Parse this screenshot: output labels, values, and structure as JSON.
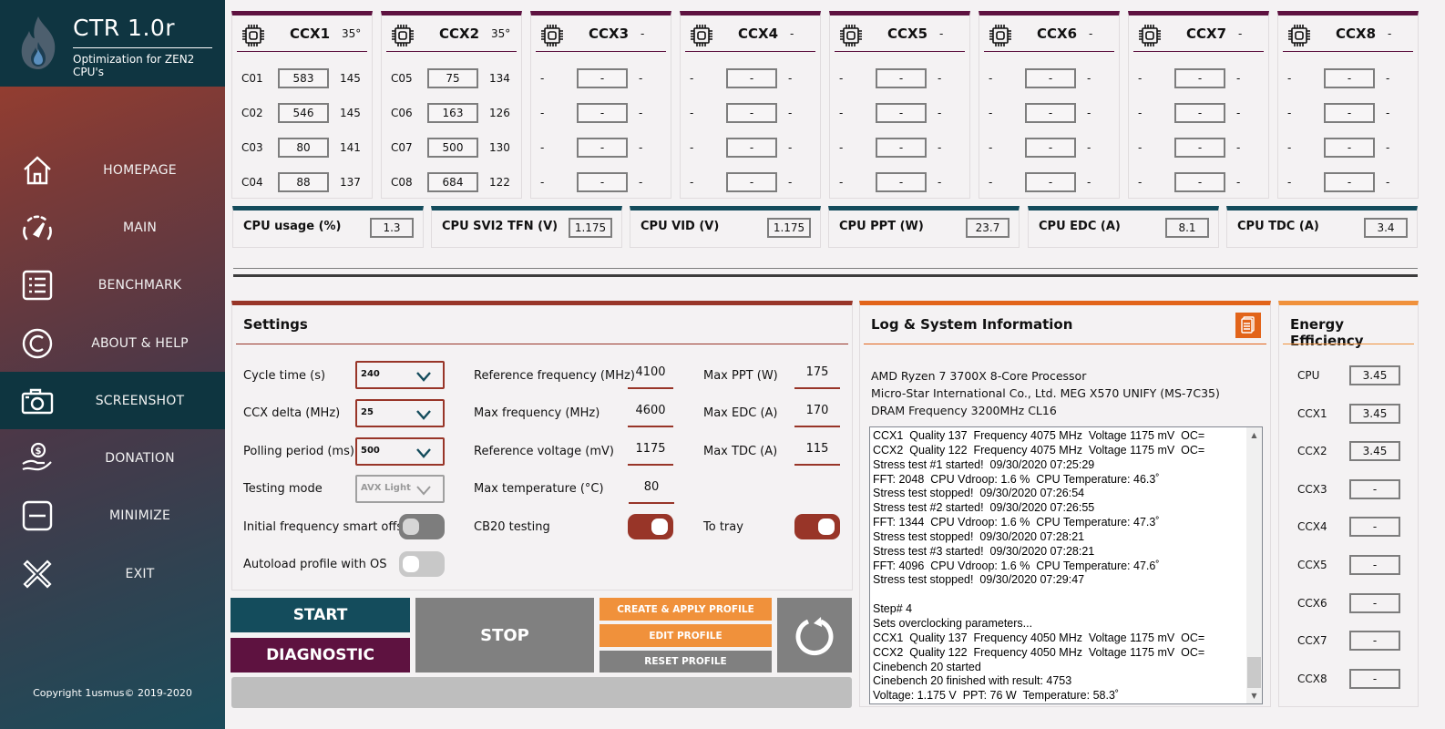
{
  "app": {
    "title": "CTR 1.0r",
    "subtitle": "Optimization for ZEN2 CPU's",
    "copyright": "Copyright 1usmus© 2019-2020"
  },
  "sidebar": {
    "items": [
      {
        "label": "HOMEPAGE",
        "icon": "home-icon",
        "active": false
      },
      {
        "label": "MAIN",
        "icon": "speedometer-icon",
        "active": false
      },
      {
        "label": "BENCHMARK",
        "icon": "list-icon",
        "active": false
      },
      {
        "label": "ABOUT & HELP",
        "icon": "copyright-icon",
        "active": false
      },
      {
        "label": "SCREENSHOT",
        "icon": "camera-icon",
        "active": true
      },
      {
        "label": "DONATION",
        "icon": "donation-hand-icon",
        "active": false
      },
      {
        "label": "MINIMIZE",
        "icon": "minimize-icon",
        "active": false
      },
      {
        "label": "EXIT",
        "icon": "close-icon",
        "active": false
      }
    ]
  },
  "ccx": [
    {
      "name": "CCX1",
      "temp": "35°",
      "cores": [
        {
          "label": "C01",
          "value": "583",
          "quality": "145"
        },
        {
          "label": "C02",
          "value": "546",
          "quality": "145"
        },
        {
          "label": "C03",
          "value": "80",
          "quality": "141"
        },
        {
          "label": "C04",
          "value": "88",
          "quality": "137"
        }
      ]
    },
    {
      "name": "CCX2",
      "temp": "35°",
      "cores": [
        {
          "label": "C05",
          "value": "75",
          "quality": "134"
        },
        {
          "label": "C06",
          "value": "163",
          "quality": "126"
        },
        {
          "label": "C07",
          "value": "500",
          "quality": "130"
        },
        {
          "label": "C08",
          "value": "684",
          "quality": "122"
        }
      ]
    },
    {
      "name": "CCX3",
      "temp": "-",
      "cores": [
        {
          "label": "-",
          "value": "-",
          "quality": "-"
        },
        {
          "label": "-",
          "value": "-",
          "quality": "-"
        },
        {
          "label": "-",
          "value": "-",
          "quality": "-"
        },
        {
          "label": "-",
          "value": "-",
          "quality": "-"
        }
      ]
    },
    {
      "name": "CCX4",
      "temp": "-",
      "cores": [
        {
          "label": "-",
          "value": "-",
          "quality": "-"
        },
        {
          "label": "-",
          "value": "-",
          "quality": "-"
        },
        {
          "label": "-",
          "value": "-",
          "quality": "-"
        },
        {
          "label": "-",
          "value": "-",
          "quality": "-"
        }
      ]
    },
    {
      "name": "CCX5",
      "temp": "-",
      "cores": [
        {
          "label": "-",
          "value": "-",
          "quality": "-"
        },
        {
          "label": "-",
          "value": "-",
          "quality": "-"
        },
        {
          "label": "-",
          "value": "-",
          "quality": "-"
        },
        {
          "label": "-",
          "value": "-",
          "quality": "-"
        }
      ]
    },
    {
      "name": "CCX6",
      "temp": "-",
      "cores": [
        {
          "label": "-",
          "value": "-",
          "quality": "-"
        },
        {
          "label": "-",
          "value": "-",
          "quality": "-"
        },
        {
          "label": "-",
          "value": "-",
          "quality": "-"
        },
        {
          "label": "-",
          "value": "-",
          "quality": "-"
        }
      ]
    },
    {
      "name": "CCX7",
      "temp": "-",
      "cores": [
        {
          "label": "-",
          "value": "-",
          "quality": "-"
        },
        {
          "label": "-",
          "value": "-",
          "quality": "-"
        },
        {
          "label": "-",
          "value": "-",
          "quality": "-"
        },
        {
          "label": "-",
          "value": "-",
          "quality": "-"
        }
      ]
    },
    {
      "name": "CCX8",
      "temp": "-",
      "cores": [
        {
          "label": "-",
          "value": "-",
          "quality": "-"
        },
        {
          "label": "-",
          "value": "-",
          "quality": "-"
        },
        {
          "label": "-",
          "value": "-",
          "quality": "-"
        },
        {
          "label": "-",
          "value": "-",
          "quality": "-"
        }
      ]
    }
  ],
  "metrics": [
    {
      "label": "CPU usage (%)",
      "value": "1.3"
    },
    {
      "label": "CPU SVI2 TFN (V)",
      "value": "1.175"
    },
    {
      "label": "CPU VID (V)",
      "value": "1.175"
    },
    {
      "label": "CPU PPT (W)",
      "value": "23.7"
    },
    {
      "label": "CPU EDC (A)",
      "value": "8.1"
    },
    {
      "label": "CPU TDC (A)",
      "value": "3.4"
    }
  ],
  "settings": {
    "title": "Settings",
    "cycle_time": {
      "label": "Cycle time (s)",
      "value": "240"
    },
    "ccx_delta": {
      "label": "CCX delta (MHz)",
      "value": "25"
    },
    "polling_period": {
      "label": "Polling period (ms)",
      "value": "500"
    },
    "testing_mode": {
      "label": "Testing mode",
      "value": "AVX Light"
    },
    "smart_offset": {
      "label": "Initial frequency smart offset",
      "on": false
    },
    "autoload": {
      "label": "Autoload profile with OS",
      "on": false
    },
    "ref_freq": {
      "label": "Reference frequency (MHz)",
      "value": "4100"
    },
    "max_freq": {
      "label": "Max frequency (MHz)",
      "value": "4600"
    },
    "ref_voltage": {
      "label": "Reference voltage (mV)",
      "value": "1175"
    },
    "max_temp": {
      "label": "Max temperature (°C)",
      "value": "80"
    },
    "cb20": {
      "label": "CB20 testing",
      "on": true
    },
    "max_ppt": {
      "label": "Max PPT (W)",
      "value": "175"
    },
    "max_edc": {
      "label": "Max EDC (A)",
      "value": "170"
    },
    "max_tdc": {
      "label": "Max TDC (A)",
      "value": "115"
    },
    "to_tray": {
      "label": "To tray",
      "on": true
    }
  },
  "buttons": {
    "start": "START",
    "diagnostic": "DIAGNOSTIC",
    "stop": "STOP",
    "create_apply": "CREATE & APPLY PROFILE",
    "edit": "EDIT PROFILE",
    "reset": "RESET PROFILE"
  },
  "progress": {
    "percent": 0
  },
  "log": {
    "title": "Log & System Information",
    "system_info": [
      "AMD Ryzen 7 3700X 8-Core Processor",
      "Micro-Star International Co., Ltd. MEG X570 UNIFY (MS-7C35)",
      "DRAM Frequency 3200MHz CL16"
    ],
    "lines": [
      "CCX1  Quality 137  Frequency 4075 MHz  Voltage 1175 mV  OC=",
      "CCX2  Quality 122  Frequency 4075 MHz  Voltage 1175 mV  OC=",
      "Stress test #1 started!  09/30/2020 07:25:29",
      "FFT: 2048  CPU Vdroop: 1.6 %  CPU Temperature: 46.3˚",
      "Stress test stopped!  09/30/2020 07:26:54",
      "Stress test #2 started!  09/30/2020 07:26:55",
      "FFT: 1344  CPU Vdroop: 1.6 %  CPU Temperature: 47.3˚",
      "Stress test stopped!  09/30/2020 07:28:21",
      "Stress test #3 started!  09/30/2020 07:28:21",
      "FFT: 4096  CPU Vdroop: 1.6 %  CPU Temperature: 47.6˚",
      "Stress test stopped!  09/30/2020 07:29:47",
      "",
      "Step# 4",
      "Sets overclocking parameters...",
      "CCX1  Quality 137  Frequency 4050 MHz  Voltage 1175 mV  OC=",
      "CCX2  Quality 122  Frequency 4050 MHz  Voltage 1175 mV  OC=",
      "Cinebench 20 started",
      "Cinebench 20 finished with result: 4753",
      "Voltage: 1.175 V  PPT: 76 W  Temperature: 58.3˚"
    ]
  },
  "energy": {
    "title": "Energy Efficiency",
    "rows": [
      {
        "label": "CPU",
        "value": "3.45"
      },
      {
        "label": "CCX1",
        "value": "3.45"
      },
      {
        "label": "CCX2",
        "value": "3.45"
      },
      {
        "label": "CCX3",
        "value": "-"
      },
      {
        "label": "CCX4",
        "value": "-"
      },
      {
        "label": "CCX5",
        "value": "-"
      },
      {
        "label": "CCX6",
        "value": "-"
      },
      {
        "label": "CCX7",
        "value": "-"
      },
      {
        "label": "CCX8",
        "value": "-"
      }
    ]
  },
  "colors": {
    "teal": "#144c5c",
    "plum": "#5e1240",
    "rust": "#983528",
    "orange": "#e2641a",
    "light_orange": "#f0913b",
    "gray": "#808080"
  }
}
